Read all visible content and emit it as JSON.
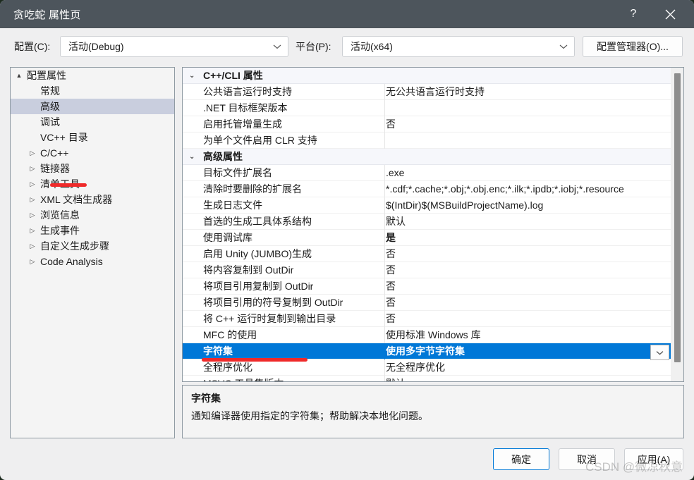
{
  "window": {
    "title": "贪吃蛇 属性页",
    "help_icon": "?",
    "close_icon": "close-icon",
    "titlebar_color": "#4d555c"
  },
  "config_bar": {
    "configuration_label": "配置(C):",
    "configuration_value": "活动(Debug)",
    "platform_label": "平台(P):",
    "platform_value": "活动(x64)",
    "config_manager_button": "配置管理器(O)..."
  },
  "sidebar": {
    "items": [
      {
        "label": "配置属性",
        "level": 0,
        "arrow": "▲",
        "selected": false
      },
      {
        "label": "常规",
        "level": 1,
        "arrow": "",
        "selected": false
      },
      {
        "label": "高级",
        "level": 1,
        "arrow": "",
        "selected": true
      },
      {
        "label": "调试",
        "level": 1,
        "arrow": "",
        "selected": false
      },
      {
        "label": "VC++ 目录",
        "level": 1,
        "arrow": "",
        "selected": false
      },
      {
        "label": "C/C++",
        "level": 1,
        "arrow": "▷",
        "selected": false
      },
      {
        "label": "链接器",
        "level": 1,
        "arrow": "▷",
        "selected": false
      },
      {
        "label": "清单工具",
        "level": 1,
        "arrow": "▷",
        "selected": false
      },
      {
        "label": "XML 文档生成器",
        "level": 1,
        "arrow": "▷",
        "selected": false
      },
      {
        "label": "浏览信息",
        "level": 1,
        "arrow": "▷",
        "selected": false
      },
      {
        "label": "生成事件",
        "level": 1,
        "arrow": "▷",
        "selected": false
      },
      {
        "label": "自定义生成步骤",
        "level": 1,
        "arrow": "▷",
        "selected": false
      },
      {
        "label": "Code Analysis",
        "level": 1,
        "arrow": "▷",
        "selected": false
      }
    ]
  },
  "grid": {
    "rows": [
      {
        "kind": "section",
        "name": "C++/CLI 属性",
        "value": "",
        "chevron": "⌄"
      },
      {
        "kind": "prop",
        "name": "公共语言运行时支持",
        "value": "无公共语言运行时支持"
      },
      {
        "kind": "prop",
        "name": ".NET 目标框架版本",
        "value": ""
      },
      {
        "kind": "prop",
        "name": "启用托管增量生成",
        "value": "否"
      },
      {
        "kind": "prop",
        "name": "为单个文件启用 CLR 支持",
        "value": ""
      },
      {
        "kind": "section",
        "name": "高级属性",
        "value": "",
        "chevron": "⌄"
      },
      {
        "kind": "prop",
        "name": "目标文件扩展名",
        "value": ".exe"
      },
      {
        "kind": "prop",
        "name": "清除时要删除的扩展名",
        "value": "*.cdf;*.cache;*.obj;*.obj.enc;*.ilk;*.ipdb;*.iobj;*.resource"
      },
      {
        "kind": "prop",
        "name": "生成日志文件",
        "value": "$(IntDir)$(MSBuildProjectName).log"
      },
      {
        "kind": "prop",
        "name": "首选的生成工具体系结构",
        "value": "默认"
      },
      {
        "kind": "prop",
        "name": "使用调试库",
        "value": "是",
        "bold": true
      },
      {
        "kind": "prop",
        "name": "启用 Unity (JUMBO)生成",
        "value": "否"
      },
      {
        "kind": "prop",
        "name": "将内容复制到 OutDir",
        "value": "否"
      },
      {
        "kind": "prop",
        "name": "将项目引用复制到 OutDir",
        "value": "否"
      },
      {
        "kind": "prop",
        "name": "将项目引用的符号复制到 OutDir",
        "value": "否"
      },
      {
        "kind": "prop",
        "name": "将 C++ 运行时复制到输出目录",
        "value": "否"
      },
      {
        "kind": "prop",
        "name": "MFC 的使用",
        "value": "使用标准 Windows 库"
      },
      {
        "kind": "prop",
        "name": "字符集",
        "value": "使用多字节字符集",
        "selected": true,
        "bold": true
      },
      {
        "kind": "prop",
        "name": "全程序优化",
        "value": "无全程序优化"
      },
      {
        "kind": "prop",
        "name": "MSVC 工具集版本",
        "value": "默认"
      }
    ],
    "dropdown_icon": "chevron-down-icon"
  },
  "description": {
    "title": "字符集",
    "body": "通知编译器使用指定的字符集；帮助解决本地化问题。"
  },
  "footer": {
    "ok_label": "确定",
    "cancel_label": "取消",
    "apply_label": "应用(A)"
  },
  "watermark": {
    "text": "CSDN @微凉秋意"
  },
  "colors": {
    "accent": "#0078d7",
    "titlebar": "#4d555c",
    "sidebar_selection": "#c9cede",
    "annotation_red": "#ef2a2a"
  }
}
